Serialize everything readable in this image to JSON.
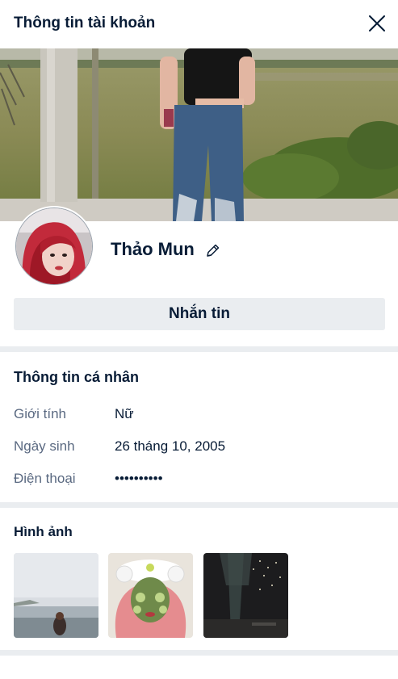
{
  "header": {
    "title": "Thông tin tài khoản"
  },
  "profile": {
    "name": "Thảo Mun"
  },
  "actions": {
    "message_label": "Nhắn tin"
  },
  "personal_info": {
    "title": "Thông tin cá nhân",
    "rows": [
      {
        "label": "Giới tính",
        "value": "Nữ"
      },
      {
        "label": "Ngày sinh",
        "value": "26 tháng 10, 2005"
      },
      {
        "label": "Điện thoại",
        "value": "••••••••••"
      }
    ]
  },
  "photos": {
    "title": "Hình ảnh",
    "count": 3
  },
  "colors": {
    "text": "#081c36",
    "muted": "#5a6981",
    "button_bg": "#eaedf0",
    "divider": "#eaedf0"
  },
  "icons": [
    "close-icon",
    "edit-pencil-icon"
  ]
}
